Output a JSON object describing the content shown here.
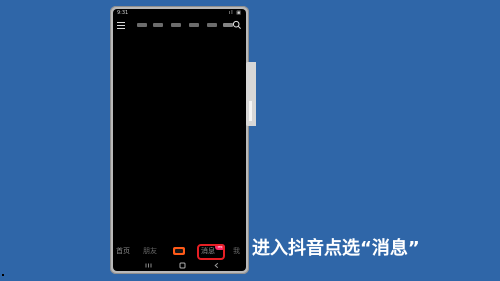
{
  "status_bar": {
    "time": "9:31",
    "icons": "ıl ▣"
  },
  "bottom_tabs": {
    "home": "首页",
    "friends": "朋友",
    "messages": "消息",
    "me": "我"
  },
  "messages_badge": "99",
  "caption": "进入抖音点选“消息”",
  "colors": {
    "background": "#2f66a8",
    "phone_frame": "#b9b9b9",
    "screen": "#000000",
    "highlight": "#e61f24",
    "badge": "#ff2b66",
    "create_button": "#ff5a18"
  },
  "icons": {
    "menu": "menu-icon",
    "search": "search-icon",
    "recent_apps": "recent-apps-icon",
    "home": "home-button-icon",
    "back": "back-icon"
  }
}
